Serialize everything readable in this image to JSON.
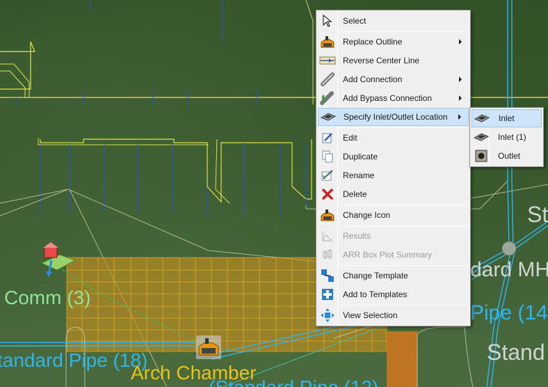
{
  "map": {
    "labels": {
      "comm": "Comm (3)",
      "standard_pipe_18": "tandard Pipe (18)",
      "arch_chamber": "Arch Chamber",
      "standard_pipe_12": "(Standard Pipe (12)",
      "st": "St",
      "standard_mh": "dard MH",
      "pipe_14": "Pipe (14",
      "standard": "Stand"
    }
  },
  "context_menu": {
    "items": [
      {
        "label": "Select",
        "icon": "cursor-icon"
      },
      {
        "label": "Replace Outline",
        "icon": "replace-outline-icon",
        "submenu": true
      },
      {
        "label": "Reverse Center Line",
        "icon": "reverse-centerline-icon"
      },
      {
        "label": "Add Connection",
        "icon": "pipe-connection-icon",
        "submenu": true
      },
      {
        "label": "Add Bypass Connection",
        "icon": "bypass-connection-icon",
        "submenu": true
      },
      {
        "label": "Specify Inlet/Outlet Location",
        "icon": "inlet-outlet-icon",
        "submenu": true,
        "highlighted": true
      },
      {
        "label": "Edit",
        "icon": "edit-icon"
      },
      {
        "label": "Duplicate",
        "icon": "duplicate-icon"
      },
      {
        "label": "Rename",
        "icon": "rename-icon"
      },
      {
        "label": "Delete",
        "icon": "delete-icon"
      },
      {
        "label": "Change Icon",
        "icon": "change-icon-icon"
      },
      {
        "label": "Results",
        "icon": "results-chart-icon",
        "disabled": true
      },
      {
        "label": "ARR Box Plot Summary",
        "icon": "box-plot-icon",
        "disabled": true
      },
      {
        "label": "Change Template",
        "icon": "change-template-icon"
      },
      {
        "label": "Add to Templates",
        "icon": "add-template-icon"
      },
      {
        "label": "View Selection",
        "icon": "view-selection-icon"
      }
    ]
  },
  "submenu": {
    "items": [
      {
        "label": "Inlet",
        "icon": "inlet-icon",
        "highlighted": true
      },
      {
        "label": "Inlet (1)",
        "icon": "inlet-icon"
      },
      {
        "label": "Outlet",
        "icon": "outlet-icon"
      }
    ]
  },
  "colors": {
    "menu_background": "#f0f0f0",
    "highlight": "#cde3f7",
    "storage_fill": "#d49a1a",
    "pipe_blue": "#2fb4ee",
    "boundary_yellow": "#e6e64a"
  }
}
